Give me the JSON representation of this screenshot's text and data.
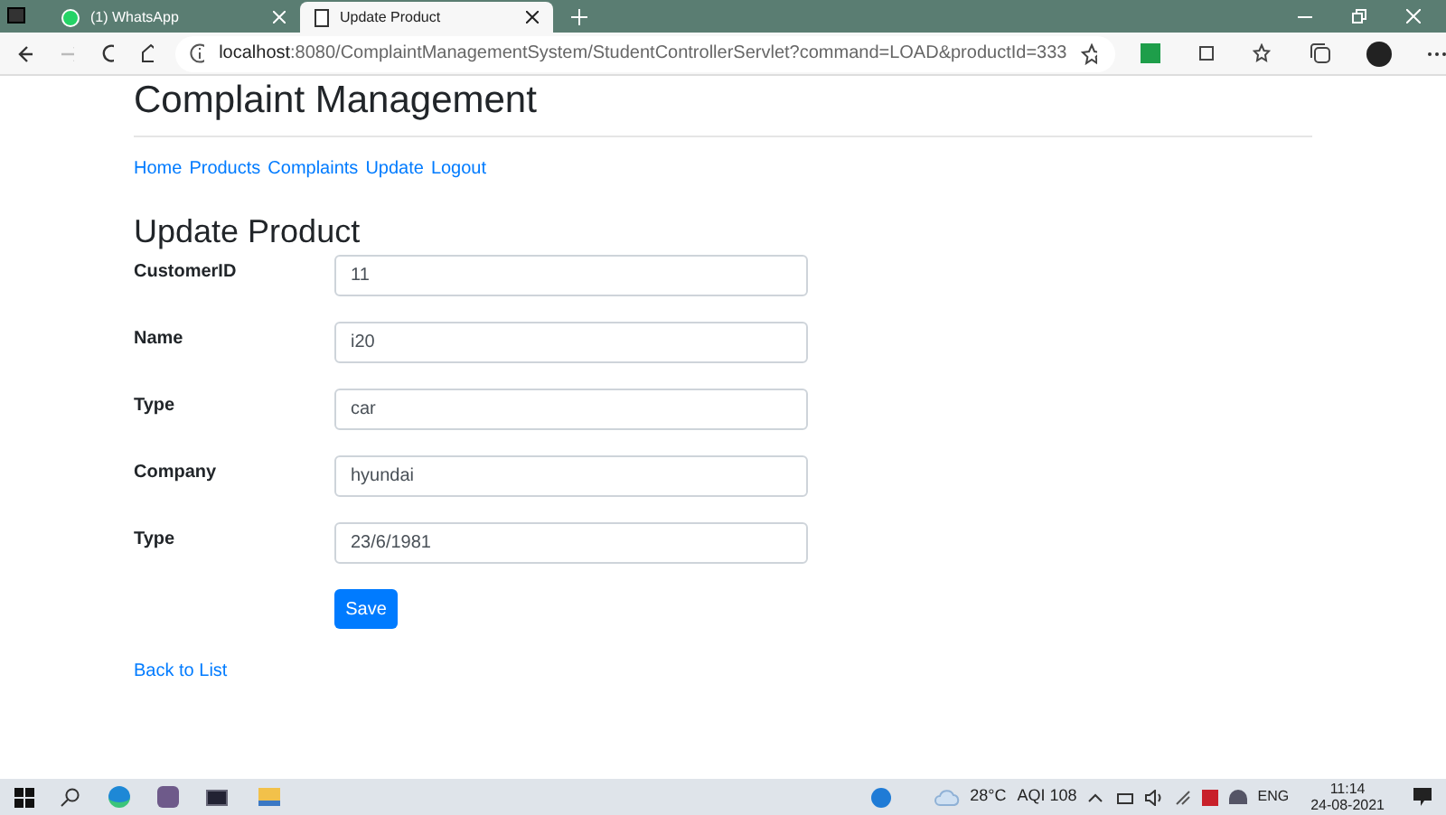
{
  "browser": {
    "tabs": [
      {
        "title": "(1) WhatsApp",
        "selected": false,
        "kind": "whatsapp"
      },
      {
        "title": "Update Product",
        "selected": true,
        "kind": "page"
      }
    ],
    "url_host": "localhost",
    "url_rest": ":8080/ComplaintManagementSystem/StudentControllerServlet?command=LOAD&productId=333"
  },
  "page": {
    "title": "Complaint Management",
    "nav": [
      "Home",
      "Products",
      "Complaints",
      "Update",
      "Logout"
    ],
    "heading": "Update Product",
    "fields": [
      {
        "label": "CustomerID",
        "value": "11"
      },
      {
        "label": "Name",
        "value": "i20"
      },
      {
        "label": "Type",
        "value": "car"
      },
      {
        "label": "Company",
        "value": "hyundai"
      },
      {
        "label": "Type",
        "value": "23/6/1981"
      }
    ],
    "save": "Save",
    "back": "Back to List"
  },
  "taskbar": {
    "weather": "28°C",
    "aqi": "AQI 108",
    "lang": "ENG",
    "time": "11:14",
    "date": "24-08-2021"
  }
}
